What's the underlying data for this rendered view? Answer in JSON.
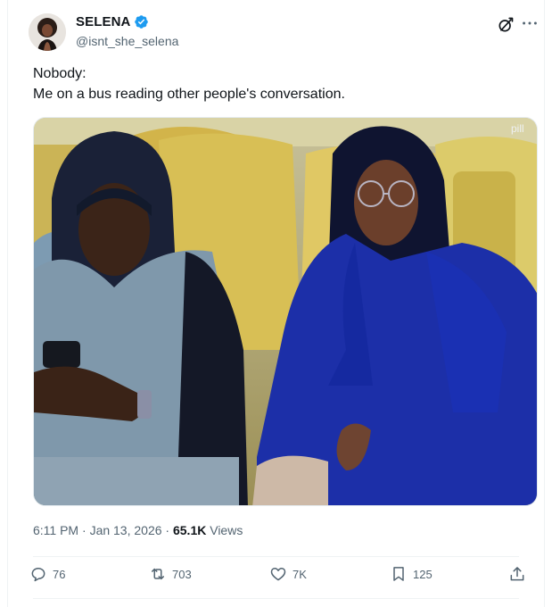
{
  "author": {
    "display_name": "SELENA",
    "handle": "@isnt_she_selena",
    "verified": true,
    "verified_color": "#1d9bf0"
  },
  "tweet": {
    "lines": [
      "Nobody:",
      "Me on a bus reading other people's conversation."
    ],
    "media_watermark": "pill"
  },
  "meta": {
    "time": "6:11 PM",
    "separator1": "·",
    "date": "Jan 13, 2026",
    "separator2": "·",
    "views_count": "65.1K",
    "views_label": "Views"
  },
  "actions": {
    "replies": "76",
    "reposts": "703",
    "likes": "7K",
    "bookmarks": "125"
  },
  "icons": {
    "grok": "grok-icon",
    "more": "more-icon",
    "reply": "reply-icon",
    "repost": "repost-icon",
    "like": "heart-icon",
    "bookmark": "bookmark-icon",
    "share": "share-icon"
  }
}
